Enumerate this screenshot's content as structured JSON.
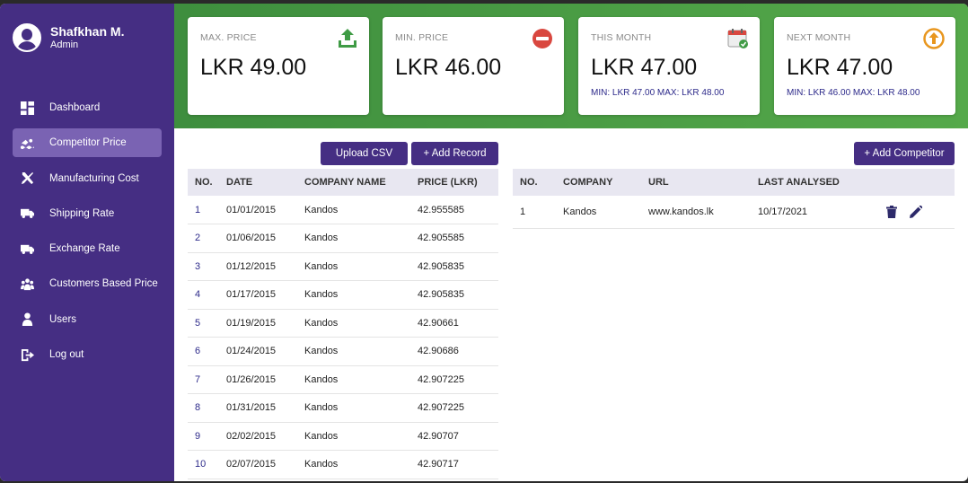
{
  "user": {
    "name": "Shafkhan M.",
    "role": "Admin"
  },
  "nav": [
    {
      "label": "Dashboard",
      "icon": "dashboard-icon"
    },
    {
      "label": "Competitor Price",
      "icon": "swimmer-icon",
      "active": true
    },
    {
      "label": "Manufacturing Cost",
      "icon": "tools-icon"
    },
    {
      "label": "Shipping Rate",
      "icon": "shipping-truck-icon"
    },
    {
      "label": "Exchange Rate",
      "icon": "truck-icon"
    },
    {
      "label": "Customers Based Price",
      "icon": "users-group-icon"
    },
    {
      "label": "Users",
      "icon": "user-icon"
    },
    {
      "label": "Log out",
      "icon": "logout-icon"
    }
  ],
  "stats": {
    "max_price": {
      "label": "MAX. PRICE",
      "value": "LKR 49.00",
      "icon": "upload-icon"
    },
    "min_price": {
      "label": "MIN. PRICE",
      "value": "LKR 46.00",
      "icon": "minus-circle-icon"
    },
    "this_month": {
      "label": "THIS MONTH",
      "value": "LKR 47.00",
      "sub": "MIN: LKR 47.00  MAX: LKR 48.00",
      "icon": "calendar-check-icon"
    },
    "next_month": {
      "label": "NEXT MONTH",
      "value": "LKR 47.00",
      "sub": "MIN: LKR 46.00  MAX: LKR 48.00",
      "icon": "arrow-up-circle-icon"
    }
  },
  "colors": {
    "sidebar": "#452e83",
    "active_nav": "#7a63b3",
    "banner": "#4a9e44",
    "button": "#452e83"
  },
  "actions": {
    "upload_csv": "Upload CSV",
    "add_record": "+ Add Record",
    "add_competitor": "+ Add Competitor"
  },
  "records": {
    "headers": [
      "NO.",
      "DATE",
      "COMPANY NAME",
      "PRICE (LKR)"
    ],
    "rows": [
      [
        "1",
        "01/01/2015",
        "Kandos",
        "42.955585"
      ],
      [
        "2",
        "01/06/2015",
        "Kandos",
        "42.905585"
      ],
      [
        "3",
        "01/12/2015",
        "Kandos",
        "42.905835"
      ],
      [
        "4",
        "01/17/2015",
        "Kandos",
        "42.905835"
      ],
      [
        "5",
        "01/19/2015",
        "Kandos",
        "42.90661"
      ],
      [
        "6",
        "01/24/2015",
        "Kandos",
        "42.90686"
      ],
      [
        "7",
        "01/26/2015",
        "Kandos",
        "42.907225"
      ],
      [
        "8",
        "01/31/2015",
        "Kandos",
        "42.907225"
      ],
      [
        "9",
        "02/02/2015",
        "Kandos",
        "42.90707"
      ],
      [
        "10",
        "02/07/2015",
        "Kandos",
        "42.90717"
      ]
    ]
  },
  "competitors": {
    "headers": [
      "NO.",
      "COMPANY",
      "URL",
      "LAST ANALYSED",
      ""
    ],
    "rows": [
      [
        "1",
        "Kandos",
        "www.kandos.lk",
        "10/17/2021"
      ]
    ]
  }
}
